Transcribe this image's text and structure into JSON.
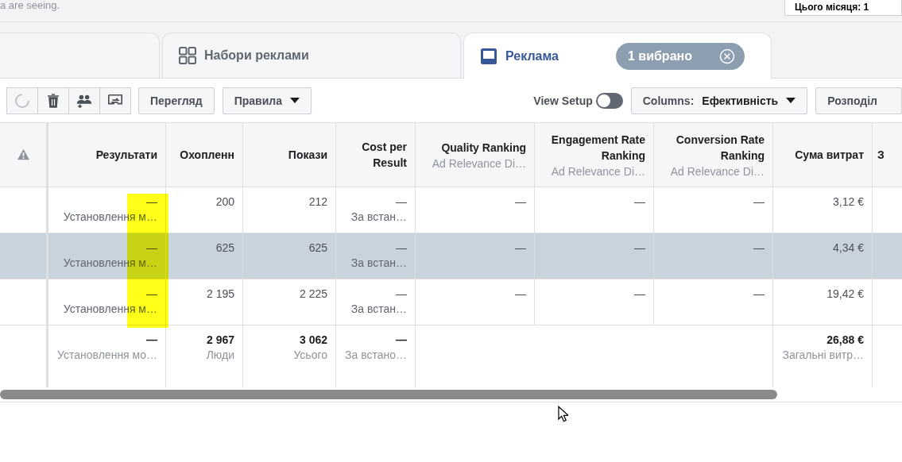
{
  "top_bar": {
    "note": "a are seeing.",
    "date_button": "Цього місяця: 1"
  },
  "tabs": [
    {
      "label": "Набори реклами",
      "selected": false
    },
    {
      "label": "Реклама",
      "selected": true,
      "badge": "1 вибрано"
    }
  ],
  "toolbar": {
    "icon_buttons": [
      {
        "disabled": true
      },
      {
        "disabled": false
      },
      {
        "disabled": false
      },
      {
        "disabled": false
      }
    ],
    "view_button": "Перегляд",
    "rules_button": "Правила",
    "view_setup": {
      "label": "View Setup",
      "on": false
    },
    "columns_button": {
      "label": "Columns:",
      "value": "Ефективність"
    },
    "breakdown_button": "Розподіл"
  },
  "table": {
    "columns": [
      {
        "title": "Результати"
      },
      {
        "title": "Охопленн"
      },
      {
        "title": "Покази"
      },
      {
        "title": "Cost per Result"
      },
      {
        "title": "Quality Ranking",
        "sub": "Ad Relevance Di…"
      },
      {
        "title": "Engagement Rate Ranking",
        "sub": "Ad Relevance Di…"
      },
      {
        "title": "Conversion Rate Ranking",
        "sub": "Ad Relevance Di…"
      },
      {
        "title": "Сума витрат"
      },
      {
        "title": "З"
      }
    ],
    "rows": [
      {
        "selected": false,
        "cells": [
          {
            "value": "—",
            "sub": "Установлення м…"
          },
          {
            "value": "200"
          },
          {
            "value": "212"
          },
          {
            "value": "—",
            "sub": "За встан…"
          },
          {
            "value": "—"
          },
          {
            "value": "—"
          },
          {
            "value": "—"
          },
          {
            "value": "3,12 €"
          }
        ]
      },
      {
        "selected": true,
        "cells": [
          {
            "value": "—",
            "sub": "Установлення м…"
          },
          {
            "value": "625"
          },
          {
            "value": "625"
          },
          {
            "value": "—",
            "sub": "За встан…"
          },
          {
            "value": "—"
          },
          {
            "value": "—"
          },
          {
            "value": "—"
          },
          {
            "value": "4,34 €"
          }
        ]
      },
      {
        "selected": false,
        "cells": [
          {
            "value": "—",
            "sub": "Установлення м…"
          },
          {
            "value": "2 195"
          },
          {
            "value": "2 225"
          },
          {
            "value": "—",
            "sub": "За встан…"
          },
          {
            "value": "—"
          },
          {
            "value": "—"
          },
          {
            "value": "—"
          },
          {
            "value": "19,42 €"
          }
        ]
      }
    ],
    "summary": {
      "cells": [
        {
          "value": "—",
          "sub": "Установлення мо…"
        },
        {
          "value": "2 967",
          "sub": "Люди"
        },
        {
          "value": "3 062",
          "sub": "Усього"
        },
        {
          "value": "—",
          "sub": "За встано…"
        }
      ],
      "spend": {
        "value": "26,88 €",
        "sub": "Загальні витр…"
      }
    }
  }
}
